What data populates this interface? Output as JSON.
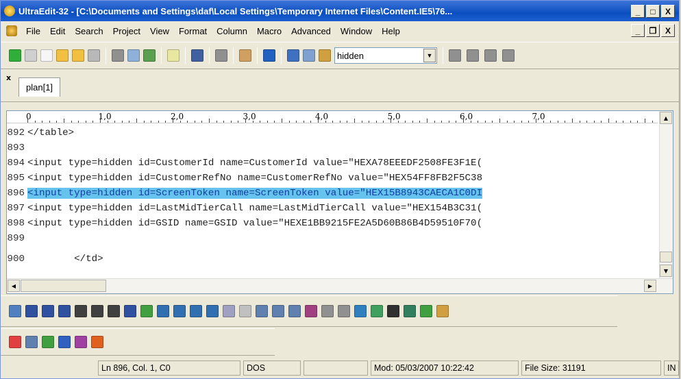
{
  "window": {
    "title": "UltraEdit-32 - [C:\\Documents and Settings\\daf\\Local Settings\\Temporary Internet Files\\Content.IE5\\76...",
    "minimize": "_",
    "maximize": "□",
    "close": "X",
    "doc_minimize": "_",
    "doc_restore": "❐",
    "doc_close": "X"
  },
  "menu": [
    "File",
    "Edit",
    "Search",
    "Project",
    "View",
    "Format",
    "Column",
    "Macro",
    "Advanced",
    "Window",
    "Help"
  ],
  "toolbar": {
    "find_value": "hidden",
    "left_icons": [
      [
        "back-icon",
        "#2fae3a"
      ],
      [
        "forward-icon",
        "#cfcfcf"
      ],
      [
        "new-file-icon",
        "#f6f6f6"
      ],
      [
        "open-file-icon",
        "#f2c040"
      ],
      [
        "open-folder-icon",
        "#f2c040"
      ],
      [
        "save-icon",
        "#b8b8b8"
      ],
      "|",
      [
        "print-icon",
        "#909090"
      ],
      [
        "print-preview-icon",
        "#8fb0d8"
      ],
      [
        "spell-check-icon",
        "#5aa050"
      ],
      "|",
      [
        "document-icon",
        "#e8e8a0"
      ],
      "|",
      [
        "word-wrap-icon",
        "#4060a0"
      ],
      "|",
      [
        "hex-mode-icon",
        "#909090"
      ],
      "|",
      [
        "column-mode-icon",
        "#d0a060"
      ],
      "|",
      [
        "browser-icon",
        "#2060c0"
      ],
      "|",
      [
        "cut-icon",
        "#4070c0"
      ],
      [
        "copy-icon",
        "#80a0d0"
      ],
      [
        "paste-icon",
        "#d0a040"
      ]
    ],
    "right_icons": [
      [
        "align-left-icon",
        "#909090"
      ],
      [
        "align-center-icon",
        "#909090"
      ],
      [
        "align-right-icon",
        "#909090"
      ],
      [
        "justify-icon",
        "#909090"
      ]
    ]
  },
  "tab": {
    "close": "x",
    "label": "plan[1]"
  },
  "ruler": [
    "0",
    "1,0",
    "2,0",
    "3,0",
    "4,0",
    "5,0",
    "6,0",
    "7,0"
  ],
  "lines": [
    {
      "num": "892",
      "code": "</table>"
    },
    {
      "num": "893",
      "code": ""
    },
    {
      "num": "894",
      "code": "<input type=hidden id=CustomerId name=CustomerId value=\"HEXA78EEEDF2508FE3F1E("
    },
    {
      "num": "895",
      "code": "<input type=hidden id=CustomerRefNo name=CustomerRefNo value=\"HEX54FF8FB2F5C38"
    },
    {
      "num": "896",
      "code": "<input type=hidden id=ScreenToken name=ScreenToken value=\"HEX15B8943CAECA1C0DI",
      "selected": true
    },
    {
      "num": "897",
      "code": "<input type=hidden id=LastMidTierCall name=LastMidTierCall value=\"HEX154B3C31("
    },
    {
      "num": "898",
      "code": "<input type=hidden id=GSID name=GSID value=\"HEXE1BB9215FE2A5D60B86B4D59510F70("
    },
    {
      "num": "899",
      "code": ""
    },
    {
      "num": "900",
      "code": "        </td>"
    }
  ],
  "html_toolbar": [
    [
      "html-tag-icon",
      "#5080c0"
    ],
    [
      "bold-icon",
      "#3050a0"
    ],
    [
      "italic-icon",
      "#3050a0"
    ],
    [
      "underline-icon",
      "#3050a0"
    ],
    [
      "indent-icon",
      "#404040"
    ],
    [
      "bullet-list-icon",
      "#404040"
    ],
    [
      "numbered-list-icon",
      "#404040"
    ],
    [
      "font-color-icon",
      "#3050a0"
    ],
    [
      "highlight-icon",
      "#40a040"
    ],
    [
      "heading1-icon",
      "#3070b0"
    ],
    [
      "heading2-icon",
      "#3070b0"
    ],
    [
      "heading3-icon",
      "#3070b0"
    ],
    [
      "heading4-icon",
      "#3070b0"
    ],
    [
      "form-icon",
      "#a0a0c0"
    ],
    [
      "button-icon",
      "#c0c0c0"
    ],
    [
      "text-field-icon",
      "#6080b0"
    ],
    [
      "textarea-icon",
      "#6080b0"
    ],
    [
      "password-icon",
      "#6080b0"
    ],
    [
      "file-field-icon",
      "#a04080"
    ],
    [
      "checkbox-icon",
      "#909090"
    ],
    [
      "radio-icon",
      "#909090"
    ],
    [
      "image-frame-icon",
      "#3080c0"
    ],
    [
      "picture-icon",
      "#40a060"
    ],
    [
      "anchor-icon",
      "#303030"
    ],
    [
      "entity-icon",
      "#308060"
    ],
    [
      "character-icon",
      "#40a040"
    ],
    [
      "lock-icon",
      "#d0a040"
    ]
  ],
  "html_toolbar2": [
    [
      "table-icon",
      "#e04040"
    ],
    [
      "pages-icon",
      "#6080b0"
    ],
    [
      "validate-icon",
      "#40a040"
    ],
    [
      "id-icon",
      "#3060c0"
    ],
    [
      "numbering-icon",
      "#a040a0"
    ],
    [
      "style-icon",
      "#e06020"
    ]
  ],
  "status": {
    "position": "Ln 896, Col. 1, C0",
    "line_ending": "DOS",
    "blank": "",
    "modified": "Mod: 05/03/2007 10:22:42",
    "file_size": "File Size: 31191",
    "mode": "IN"
  }
}
